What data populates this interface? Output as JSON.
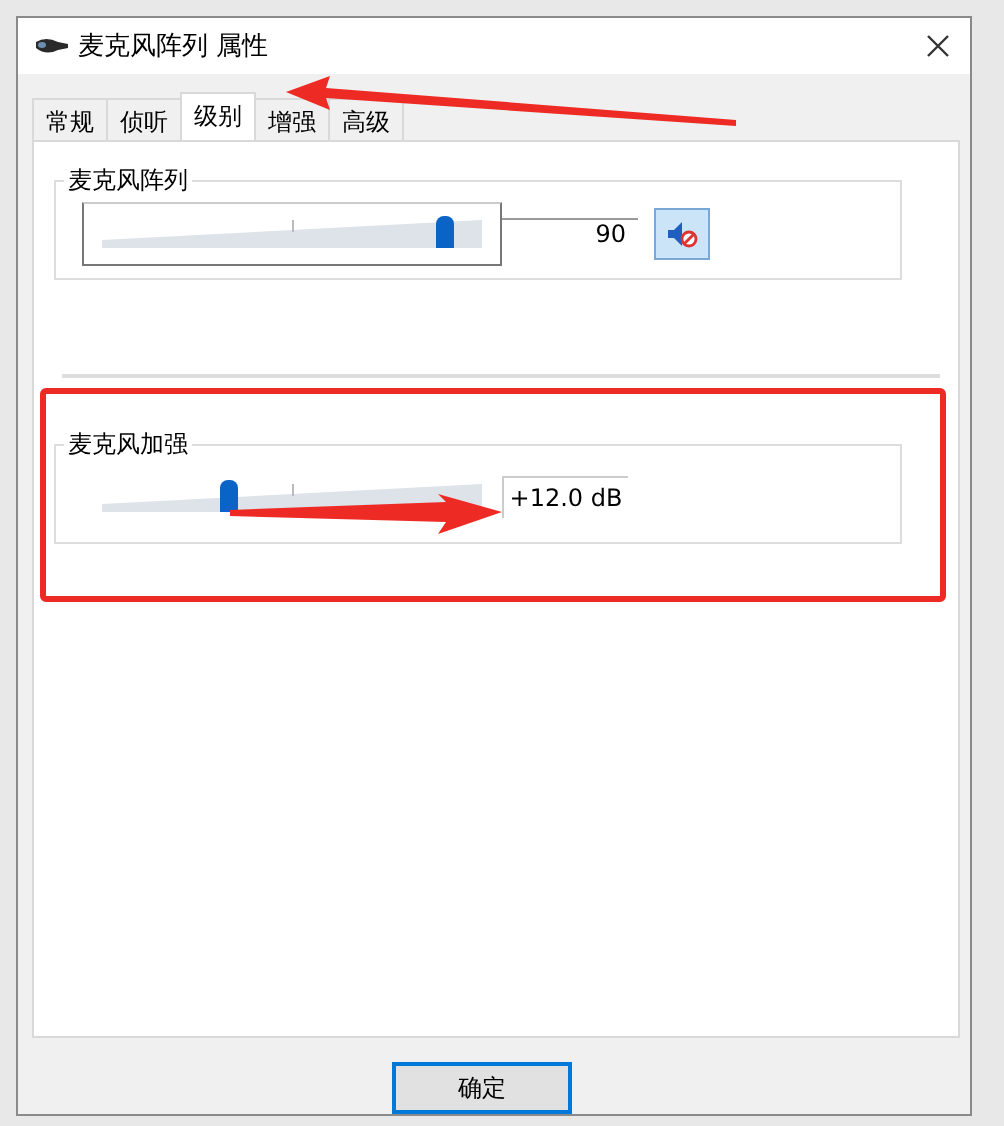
{
  "window": {
    "title": "麦克风阵列 属性"
  },
  "tabs": [
    {
      "label": "常规",
      "selected": false
    },
    {
      "label": "侦听",
      "selected": false
    },
    {
      "label": "级别",
      "selected": true
    },
    {
      "label": "增强",
      "selected": false
    },
    {
      "label": "高级",
      "selected": false
    }
  ],
  "groups": [
    {
      "title": "麦克风阵列",
      "level": 0.9,
      "reading": "90",
      "muted": true,
      "highlighted": false
    },
    {
      "title": "麦克风加强",
      "level": 0.33,
      "reading": "+12.0 dB",
      "highlighted": true
    }
  ],
  "buttons": [
    {
      "label": "确定",
      "default": true
    }
  ]
}
